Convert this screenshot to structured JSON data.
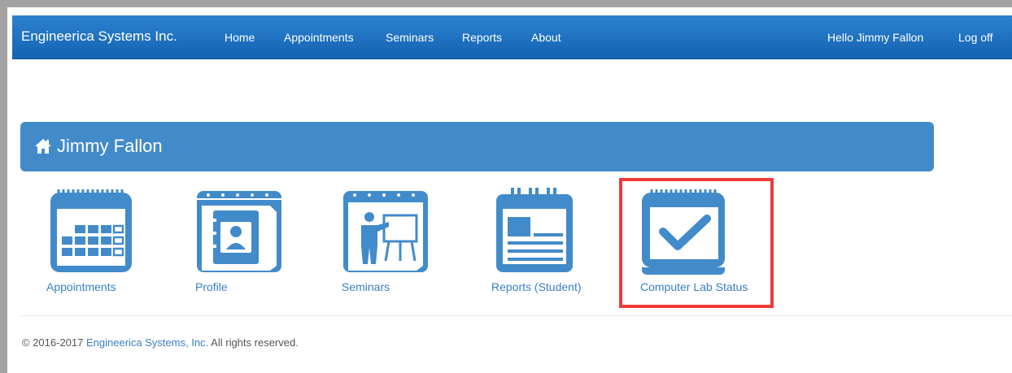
{
  "navbar": {
    "brand": "Engineerica Systems Inc.",
    "links": [
      "Home",
      "Appointments",
      "Seminars",
      "Reports",
      "About"
    ],
    "greeting": "Hello Jimmy Fallon",
    "logoff": "Log off"
  },
  "panel": {
    "title": "Jimmy Fallon",
    "icon": "home-icon"
  },
  "tiles": [
    {
      "label": "Appointments",
      "icon": "calendar-grid-icon"
    },
    {
      "label": "Profile",
      "icon": "address-book-icon"
    },
    {
      "label": "Seminars",
      "icon": "presentation-icon"
    },
    {
      "label": "Reports (Student)",
      "icon": "report-calendar-icon"
    },
    {
      "label": "Computer Lab Status",
      "icon": "calendar-check-icon"
    }
  ],
  "footer": {
    "prefix": "© 2016-2017 ",
    "company_link": "Engineerica Systems, Inc.",
    "suffix": " All rights reserved."
  },
  "colors": {
    "nav": "#1a6cbf",
    "panel": "#428bca",
    "icon": "#428bca",
    "highlight": "#ef3a3a"
  }
}
